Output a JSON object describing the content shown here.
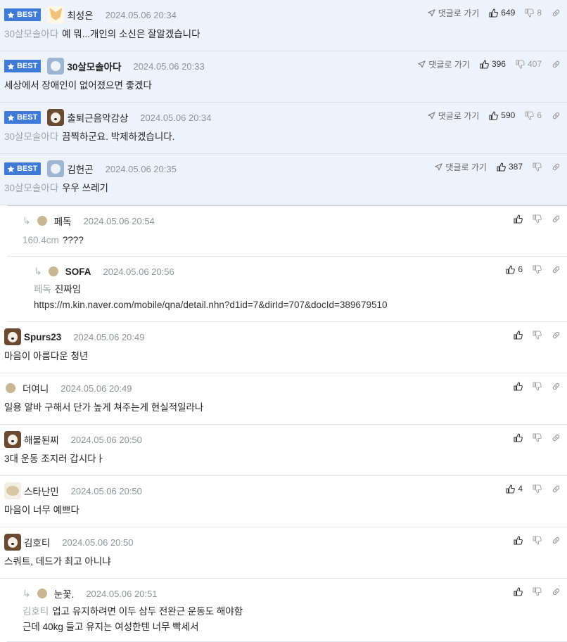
{
  "labels": {
    "best": "BEST",
    "goto": "댓글로 가기"
  },
  "colors": {
    "best_bg": "#3f7ad8",
    "best_row": "#eef2fb",
    "target_name": "#a0a4aa"
  },
  "comments": [
    {
      "best": true,
      "avatar": "fox-avatar",
      "name": "최성은",
      "date": "2024.05.06 20:34",
      "goto": true,
      "up": "649",
      "down": "8",
      "target": "30살모솔아다",
      "lines": [
        "예 뭐...개인의 소신은 잘알겠습니다"
      ]
    },
    {
      "best": true,
      "avatar": "polar-bear-avatar",
      "name": "30살모솔아다",
      "date": "2024.05.06 20:33",
      "goto": true,
      "up": "396",
      "down": "407",
      "target": "",
      "lines": [
        "세상에서 장애인이 없어졌으면 좋겠다"
      ]
    },
    {
      "best": true,
      "avatar": "dog-avatar",
      "name": "출퇴근음악감상",
      "date": "2024.05.06 20:34",
      "goto": true,
      "up": "590",
      "down": "6",
      "target": "30살모솔아다",
      "lines": [
        "끔찍하군요. 박제하겠습니다."
      ]
    },
    {
      "best": true,
      "avatar": "polar-bear-avatar",
      "name": "김헌곤",
      "date": "2024.05.06 20:35",
      "goto": true,
      "up": "387",
      "down": "",
      "target": "30살모솔아다",
      "lines": [
        "우우 쓰레기"
      ]
    },
    {
      "best": false,
      "depth": 1,
      "avatar": "dot-avatar",
      "name": "페독",
      "date": "2024.05.06 20:54",
      "goto": false,
      "up": "",
      "down": "",
      "target": "160.4cm",
      "lines": [
        "????"
      ]
    },
    {
      "best": false,
      "depth": 2,
      "avatar": "dot-avatar",
      "name": "SOFA",
      "date": "2024.05.06 20:56",
      "goto": false,
      "up": "6",
      "down": "",
      "target": "페독",
      "lines": [
        "진짜임",
        "https://m.kin.naver.com/mobile/qna/detail.nhn?d1id=7&dirId=707&docId=389679510"
      ]
    },
    {
      "best": false,
      "depth": 0,
      "avatar": "dog-avatar",
      "name": "Spurs23",
      "date": "2024.05.06 20:49",
      "goto": false,
      "up": "",
      "down": "",
      "target": "",
      "lines": [
        "마음이 아름다운 청년"
      ]
    },
    {
      "best": false,
      "depth": 0,
      "avatar": "dot-avatar",
      "name": "더여니",
      "date": "2024.05.06 20:49",
      "goto": false,
      "up": "",
      "down": "",
      "target": "",
      "lines": [
        "일용 알바 구해서 단가 높게 쳐주는게 현실적일라나"
      ]
    },
    {
      "best": false,
      "depth": 0,
      "avatar": "dog-avatar",
      "name": "해물된찌",
      "date": "2024.05.06 20:50",
      "goto": false,
      "up": "",
      "down": "",
      "target": "",
      "lines": [
        "3대 운동 조지러 갑시다ㅏ"
      ]
    },
    {
      "best": false,
      "depth": 0,
      "avatar": "puppy-avatar",
      "name": "스타난민",
      "date": "2024.05.06 20:50",
      "goto": false,
      "up": "4",
      "down": "",
      "target": "",
      "lines": [
        "마음이 너무 예쁘다"
      ]
    },
    {
      "best": false,
      "depth": 0,
      "avatar": "dog-avatar",
      "name": "김호티",
      "date": "2024.05.06 20:50",
      "goto": false,
      "up": "",
      "down": "",
      "target": "",
      "lines": [
        "스쿼트, 데드가 최고 아니냐"
      ]
    },
    {
      "best": false,
      "depth": 1,
      "avatar": "dot-avatar",
      "name": "눈꽃.",
      "date": "2024.05.06 20:51",
      "goto": false,
      "up": "",
      "down": "",
      "target": "김호티",
      "lines": [
        "업고 유지하려면 이두 삼두 전완근 운동도 해야함",
        "근데 40kg 들고 유지는 여성한텐 너무 빡세서"
      ]
    }
  ]
}
